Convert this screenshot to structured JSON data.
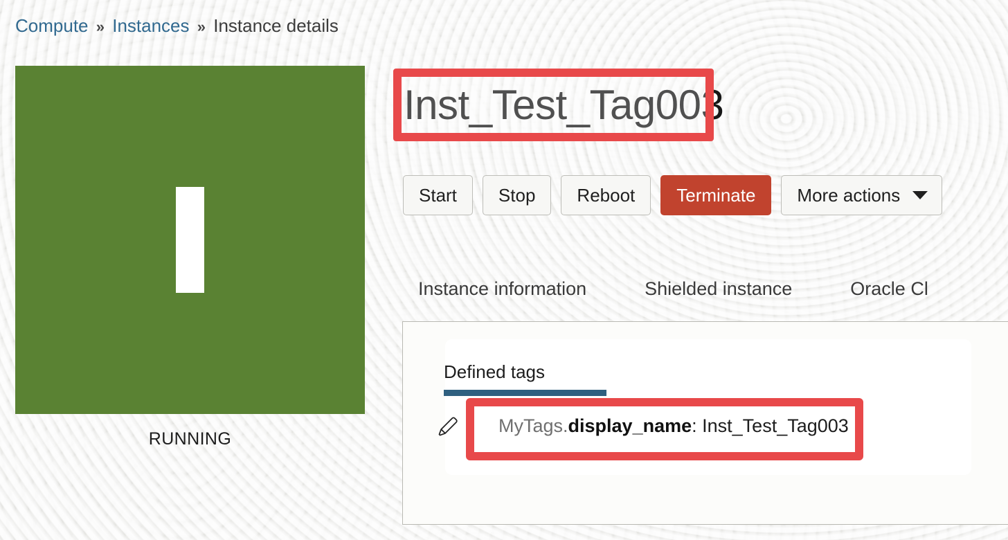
{
  "breadcrumb": {
    "items": [
      {
        "label": "Compute",
        "type": "link"
      },
      {
        "label": "Instances",
        "type": "link"
      },
      {
        "label": "Instance details",
        "type": "current"
      }
    ],
    "separator": "»"
  },
  "status_tile": {
    "state_label": "RUNNING",
    "icon": "power-bar-icon",
    "color": "#5a8233"
  },
  "header": {
    "instance_name": "Inst_Test_Tag003",
    "highlight_color": "#e8494a"
  },
  "actions": {
    "buttons": [
      {
        "label": "Start",
        "style": "default"
      },
      {
        "label": "Stop",
        "style": "default"
      },
      {
        "label": "Reboot",
        "style": "default"
      },
      {
        "label": "Terminate",
        "style": "danger"
      },
      {
        "label": "More actions",
        "style": "default",
        "caret": true
      }
    ],
    "danger_color": "#c1432e"
  },
  "tabs": {
    "items": [
      {
        "label": "Instance information",
        "selected": false
      },
      {
        "label": "Shielded instance",
        "selected": false
      },
      {
        "label": "Oracle Cl",
        "selected": false
      }
    ]
  },
  "panel": {
    "subtabs": [
      {
        "label": "Defined tags",
        "selected": true
      }
    ],
    "selected_underline_color": "#2f6080",
    "tag": {
      "namespace": "MyTags.",
      "key": "display_name",
      "separator": ": ",
      "value": "Inst_Test_Tag003",
      "edit_icon": "pencil-icon"
    }
  }
}
